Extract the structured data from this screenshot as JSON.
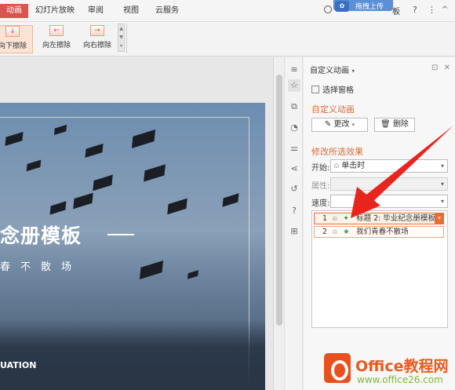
{
  "menubar": {
    "tabs": [
      "动画",
      "幻灯片放映",
      "审阅",
      "视图",
      "云服务"
    ],
    "active_tab": "动画",
    "right_partial": "板",
    "help_icon": "?",
    "more_icon": "⋮",
    "collapse_icon": "^",
    "upload_badge": "拖拽上传"
  },
  "ribbon": {
    "buttons": [
      {
        "label": "向下擦除",
        "icon": "↓",
        "selected": true
      },
      {
        "label": "向左擦除",
        "icon": "←",
        "selected": false
      },
      {
        "label": "向右擦除",
        "icon": "→",
        "selected": false
      }
    ]
  },
  "slide": {
    "title": "念册模板",
    "subtitle": "春不散场",
    "english": "UATION"
  },
  "panel": {
    "header": "自定义动画",
    "select_pane": "选择窗格",
    "section_custom": "自定义动画",
    "change_btn": "更改",
    "delete_btn": "删除",
    "section_modify": "修改所选效果",
    "start_label": "开始:",
    "start_value": "单击时",
    "property_label": "属性:",
    "property_value": "",
    "speed_label": "速度:",
    "speed_value": "",
    "items": [
      {
        "num": "1",
        "text": "标题 2: 毕业纪念册模板",
        "selected": true
      },
      {
        "num": "2",
        "text": "我们青春不散场",
        "selected": false
      }
    ]
  },
  "watermark": {
    "line1": "Office教程网",
    "line2": "www.office26.com"
  },
  "colors": {
    "accent": "#d9534f",
    "section_title": "#d9693a",
    "selection": "#e86d2e",
    "annotation": "#e8241e"
  }
}
